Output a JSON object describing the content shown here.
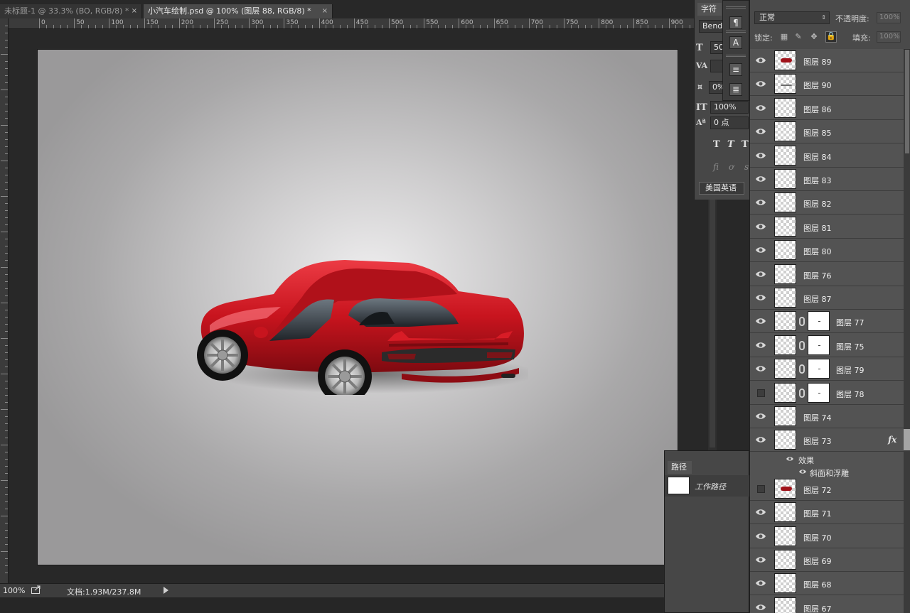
{
  "tabs": [
    {
      "title": "未标题-1 @ 33.3% (BO, RGB/8) *",
      "close": "×",
      "active": false
    },
    {
      "title": "小汽车绘制.psd @ 100% (图层 88, RGB/8) *",
      "close": "×",
      "active": true
    }
  ],
  "ruler": {
    "labels": [
      "0",
      "50",
      "100",
      "150",
      "200",
      "250",
      "300",
      "350",
      "400",
      "450",
      "500",
      "550",
      "600",
      "650",
      "700",
      "750",
      "800",
      "850",
      "900"
    ]
  },
  "status": {
    "zoom": "100%",
    "doc_size": "文档:1.93M/237.8M"
  },
  "character_panel": {
    "tab": "字符",
    "font_family": "Bende",
    "font_size": "50",
    "tracking": "0%",
    "vertical_scale": "100%",
    "baseline_shift": "0 点",
    "language": "美国英语"
  },
  "paths_panel": {
    "tab": "路径",
    "items": [
      "工作路径"
    ]
  },
  "layers_panel": {
    "blend_mode": "正常",
    "opacity_label": "不透明度:",
    "opacity_value": "100%",
    "lock_label": "锁定:",
    "fill_label": "填充:",
    "fill_value": "100%",
    "layers": [
      {
        "name": "图层 89",
        "visible": true,
        "thumb": "car-red"
      },
      {
        "name": "图层 90",
        "visible": true,
        "thumb": "line"
      },
      {
        "name": "图层 86",
        "visible": true,
        "thumb": "empty"
      },
      {
        "name": "图层 85",
        "visible": true,
        "thumb": "empty"
      },
      {
        "name": "图层 84",
        "visible": true,
        "thumb": "empty"
      },
      {
        "name": "图层 83",
        "visible": true,
        "thumb": "empty"
      },
      {
        "name": "图层 82",
        "visible": true,
        "thumb": "empty"
      },
      {
        "name": "图层 81",
        "visible": true,
        "thumb": "empty"
      },
      {
        "name": "图层 80",
        "visible": true,
        "thumb": "empty"
      },
      {
        "name": "图层 76",
        "visible": true,
        "thumb": "empty"
      },
      {
        "name": "图层 87",
        "visible": true,
        "thumb": "empty"
      },
      {
        "name": "图层 77",
        "visible": true,
        "thumb": "empty",
        "mask": true
      },
      {
        "name": "图层 75",
        "visible": true,
        "thumb": "empty",
        "mask": true
      },
      {
        "name": "图层 79",
        "visible": true,
        "thumb": "empty",
        "mask": true
      },
      {
        "name": "图层 78",
        "visible": false,
        "thumb": "empty",
        "mask": true
      },
      {
        "name": "图层 74",
        "visible": true,
        "thumb": "empty"
      },
      {
        "name": "图层 73",
        "visible": true,
        "thumb": "empty",
        "fx": "fx"
      },
      {
        "name": "图层 72",
        "visible": false,
        "thumb": "car-red"
      },
      {
        "name": "图层 71",
        "visible": true,
        "thumb": "empty"
      },
      {
        "name": "图层 70",
        "visible": true,
        "thumb": "empty"
      },
      {
        "name": "图层 69",
        "visible": true,
        "thumb": "empty"
      },
      {
        "name": "图层 68",
        "visible": true,
        "thumb": "empty"
      },
      {
        "name": "图层 67",
        "visible": true,
        "thumb": "empty"
      }
    ],
    "effects": {
      "group_label": "效果",
      "bevel_label": "斜面和浮雕"
    }
  },
  "colors": {
    "car_red": "#c8141e",
    "panel_bg": "#535353",
    "workspace": "#282828"
  }
}
